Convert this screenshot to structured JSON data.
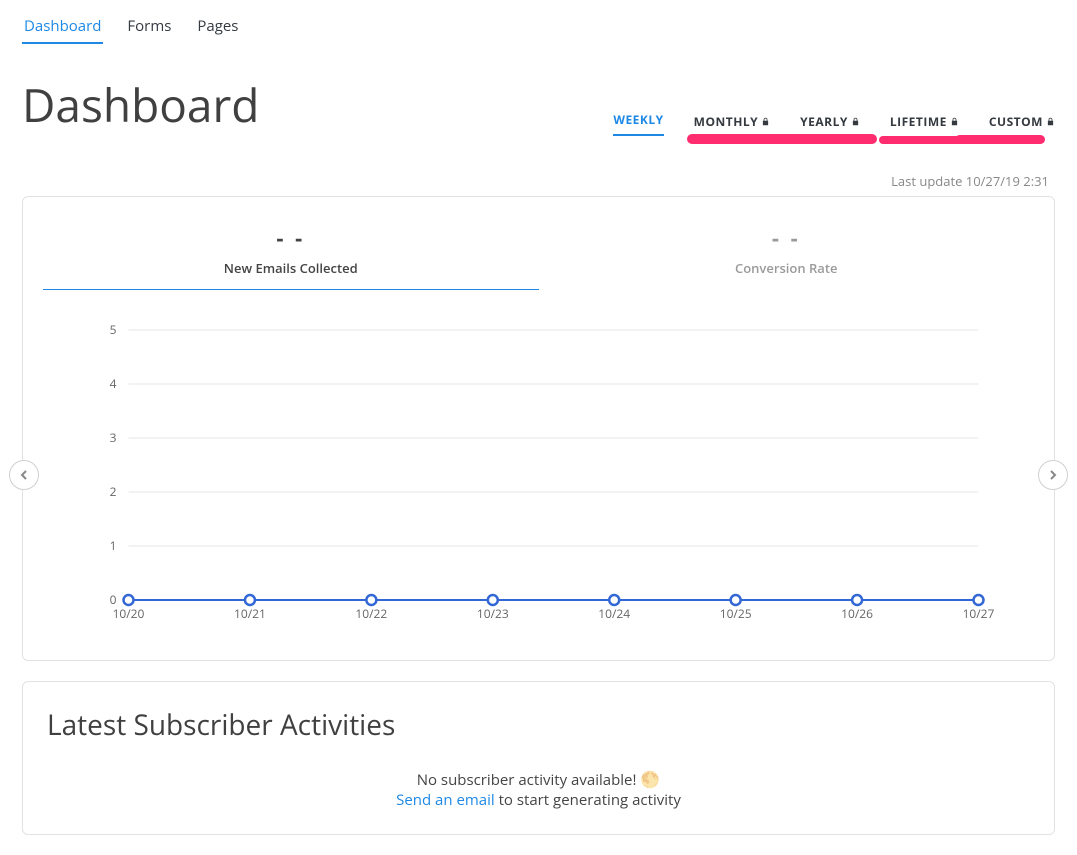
{
  "nav": {
    "items": [
      {
        "label": "Dashboard",
        "active": true
      },
      {
        "label": "Forms",
        "active": false
      },
      {
        "label": "Pages",
        "active": false
      }
    ]
  },
  "page_title": "Dashboard",
  "period_tabs": [
    {
      "label": "WEEKLY",
      "locked": false,
      "active": true
    },
    {
      "label": "MONTHLY",
      "locked": true,
      "active": false
    },
    {
      "label": "YEARLY",
      "locked": true,
      "active": false
    },
    {
      "label": "LIFETIME",
      "locked": true,
      "active": false
    },
    {
      "label": "CUSTOM",
      "locked": true,
      "active": false
    }
  ],
  "last_update": "Last update 10/27/19 2:31",
  "stat_tabs": [
    {
      "value": "- -",
      "label": "New Emails Collected",
      "active": true
    },
    {
      "value": "- -",
      "label": "Conversion Rate",
      "active": false
    }
  ],
  "chart_data": {
    "type": "line",
    "categories": [
      "10/20",
      "10/21",
      "10/22",
      "10/23",
      "10/24",
      "10/25",
      "10/26",
      "10/27"
    ],
    "values": [
      0,
      0,
      0,
      0,
      0,
      0,
      0,
      0
    ],
    "yticks": [
      0,
      1,
      2,
      3,
      4,
      5
    ],
    "ylim": [
      0,
      5
    ],
    "title": "",
    "xlabel": "",
    "ylabel": ""
  },
  "activities": {
    "title": "Latest Subscriber Activities",
    "empty_text": "No subscriber activity available!",
    "emoji": "🌕",
    "link_text": "Send an email",
    "after_link": " to start generating activity"
  },
  "colors": {
    "accent": "#1e88e5",
    "highlight": "#ff2d6f",
    "line": "#3367d6"
  }
}
